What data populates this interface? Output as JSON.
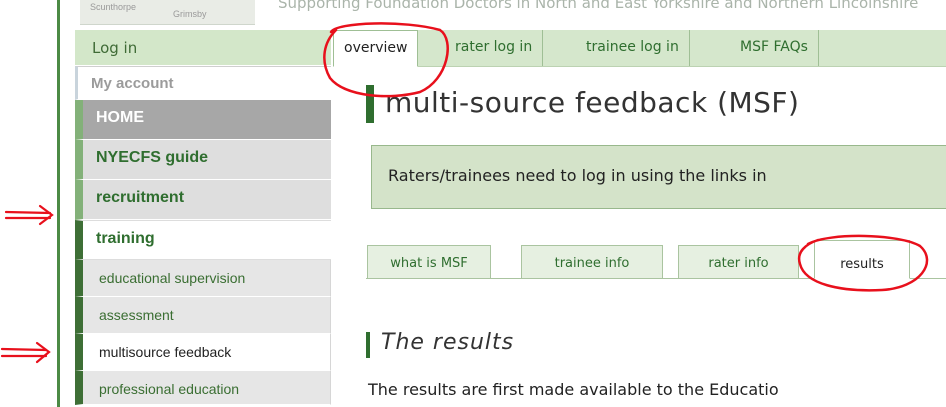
{
  "header": {
    "places": [
      "Scunthorpe",
      "Grimsby"
    ],
    "tagline": "Supporting Foundation Doctors in North and East Yorkshire and Northern Lincolnshire"
  },
  "sidebar": {
    "login": "Log in",
    "account": "My account",
    "items": [
      {
        "label": "HOME"
      },
      {
        "label": "NYECFS guide"
      },
      {
        "label": "recruitment"
      },
      {
        "label": "training"
      }
    ],
    "subitems": [
      {
        "label": "educational supervision"
      },
      {
        "label": "assessment"
      },
      {
        "label": "multisource feedback"
      },
      {
        "label": "professional education"
      }
    ]
  },
  "tabs": [
    {
      "label": "overview"
    },
    {
      "label": "rater log in"
    },
    {
      "label": "trainee log in"
    },
    {
      "label": "MSF FAQs"
    }
  ],
  "main": {
    "title": "multi-source feedback (MSF)",
    "notice": "Raters/trainees need to log in using the links in",
    "subtabs": [
      {
        "label": "what is MSF"
      },
      {
        "label": "trainee info"
      },
      {
        "label": "rater info"
      },
      {
        "label": "results"
      }
    ],
    "section_title": "The results",
    "paragraph": "The results are first made available to the Educatio"
  },
  "colors": {
    "accent": "#2f6e2f",
    "annotation": "#e8101c"
  }
}
